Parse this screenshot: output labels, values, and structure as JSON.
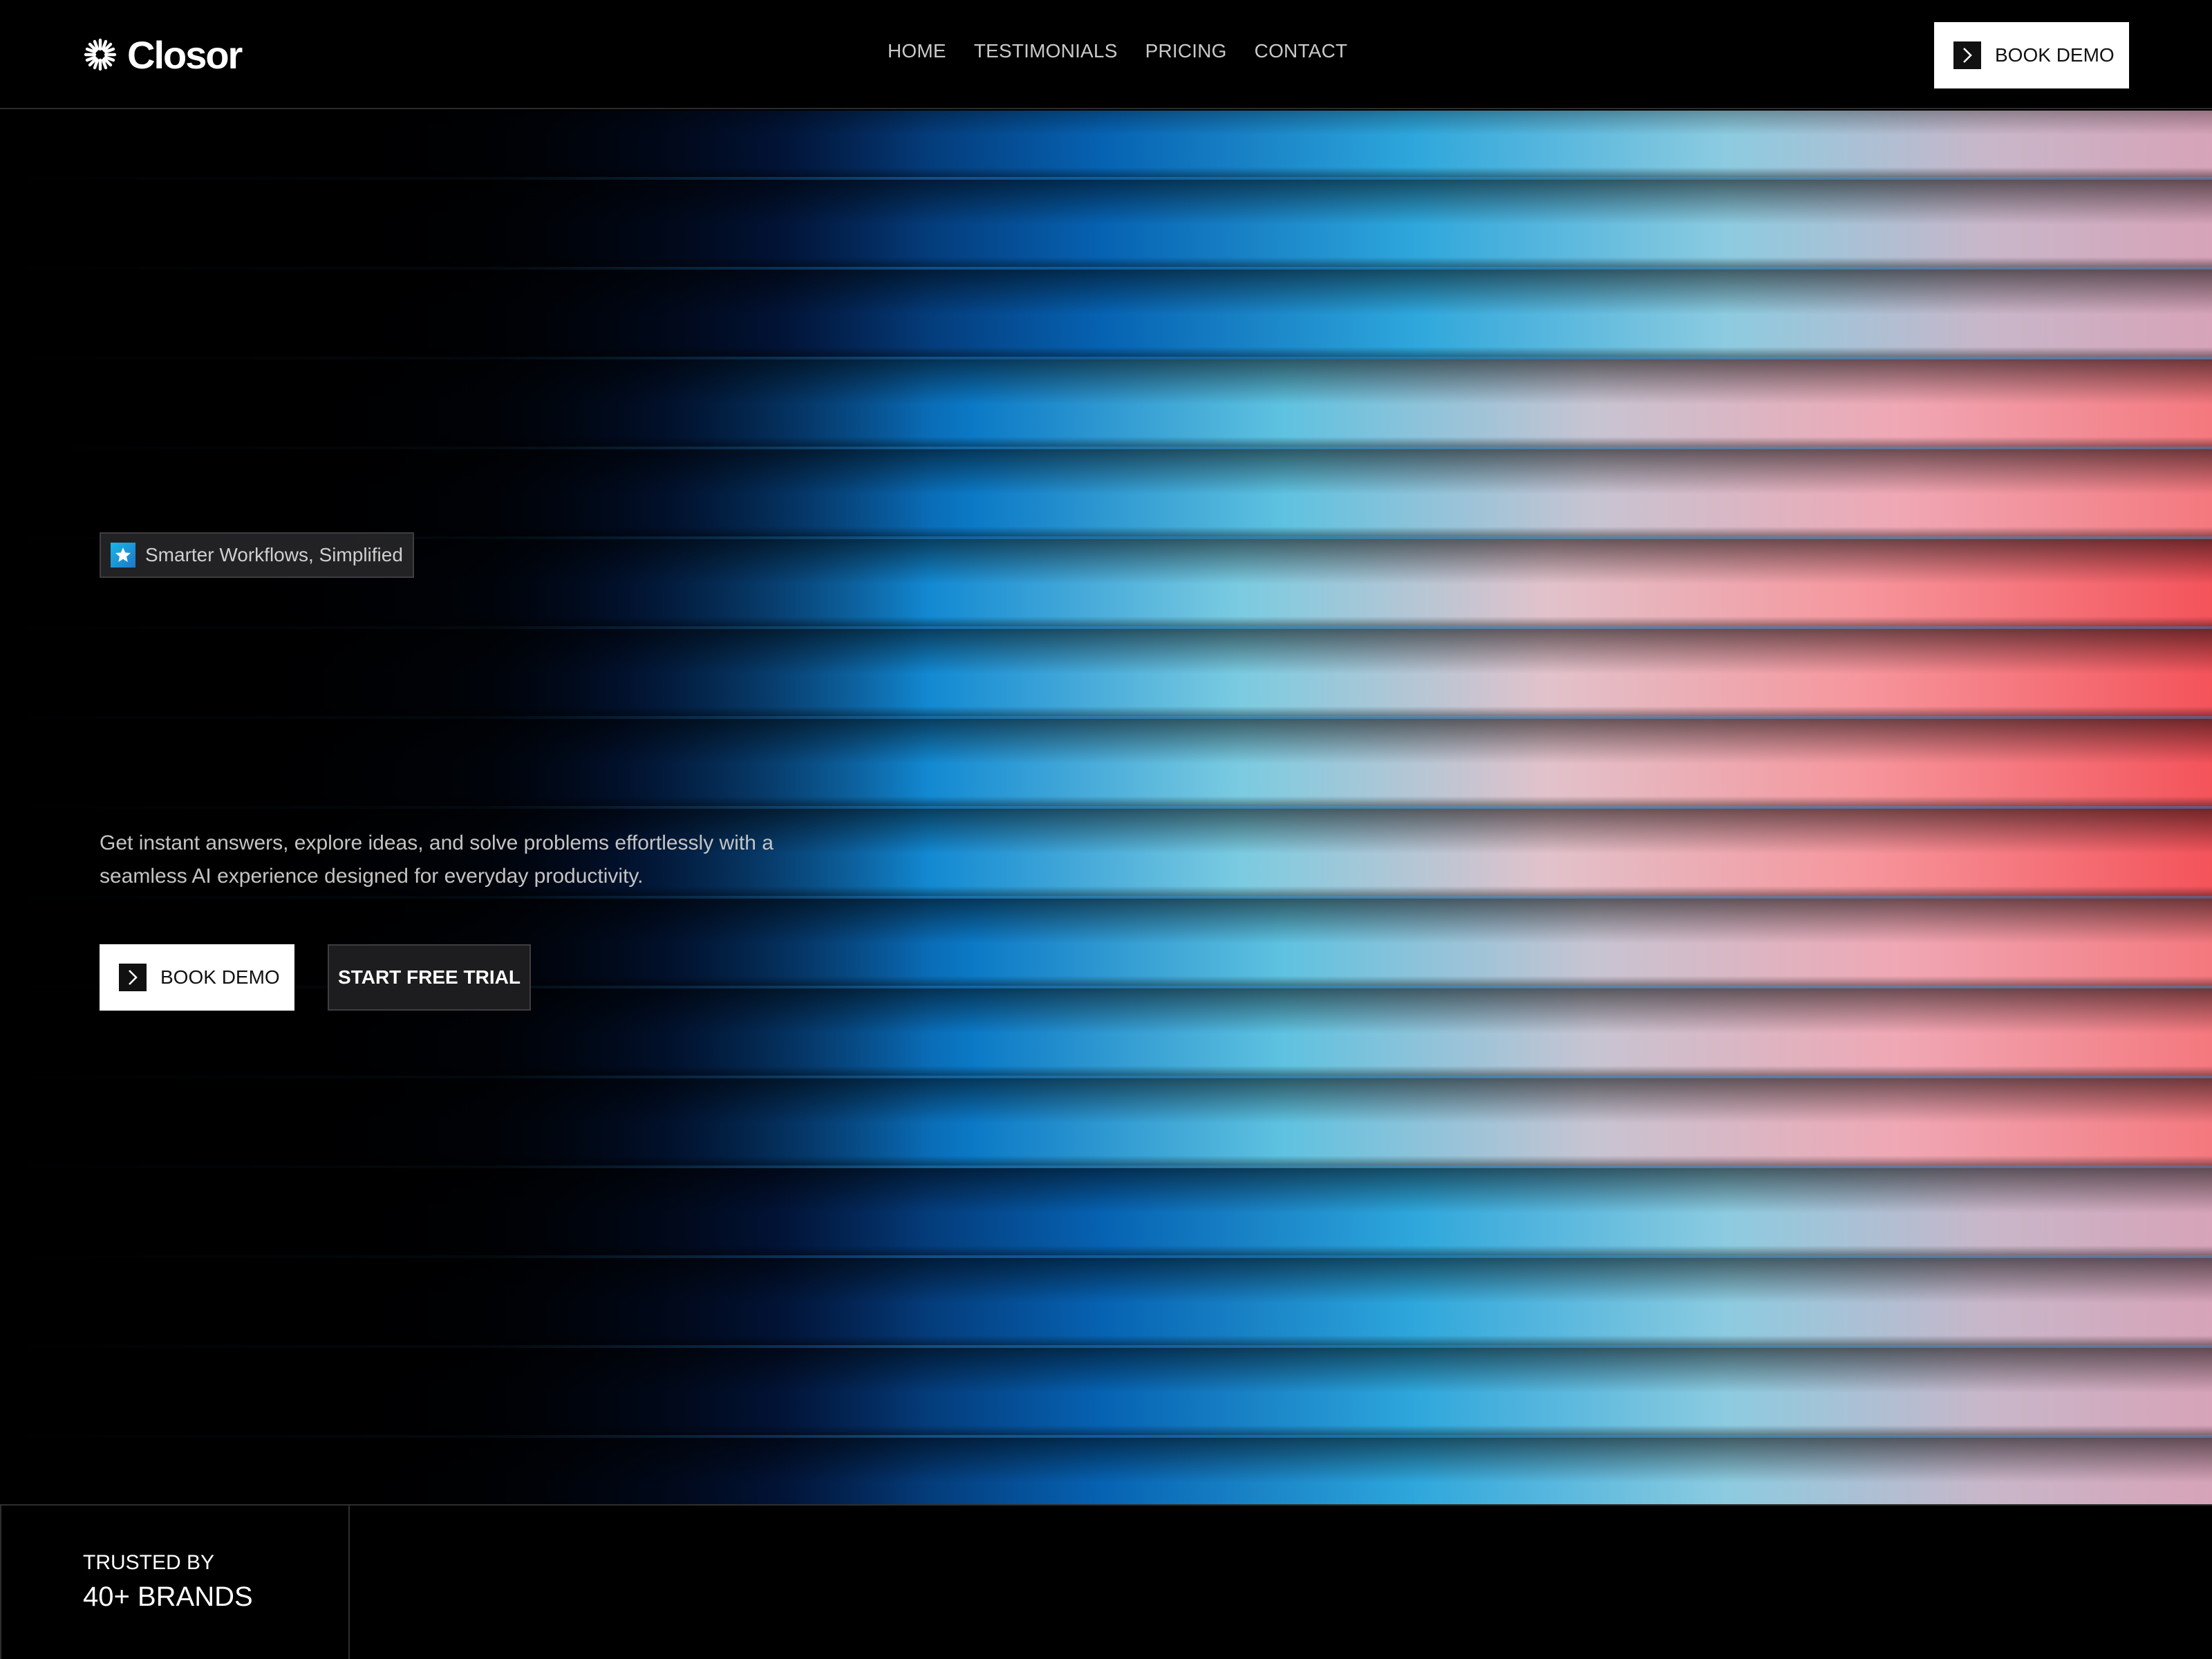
{
  "header": {
    "logo_text": "Closor",
    "nav": [
      "HOME",
      "TESTIMONIALS",
      "PRICING",
      "CONTACT"
    ],
    "book_demo_label": "BOOK DEMO"
  },
  "hero": {
    "badge_text": "Smarter Workflows, Simplified",
    "description": "Get instant answers, explore ideas, and solve problems effortlessly with a seamless AI experience designed for everyday productivity.",
    "book_demo_label": "BOOK DEMO",
    "free_trial_label": "START FREE TRIAL"
  },
  "trusted": {
    "label": "TRUSTED BY",
    "count": "40+ BRANDS"
  },
  "colors": {
    "background": "#000000",
    "glow_blue": "#1a8fd6",
    "glow_cyan": "#5ec8e6",
    "glow_pink": "#f2b6c4",
    "glow_red": "#f2555a",
    "button_white": "#ffffff",
    "button_dark": "#1d1d1f"
  },
  "icons": {
    "logo": "starburst-icon",
    "button_chevron": "chevron-right-icon",
    "badge": "star-icon"
  }
}
